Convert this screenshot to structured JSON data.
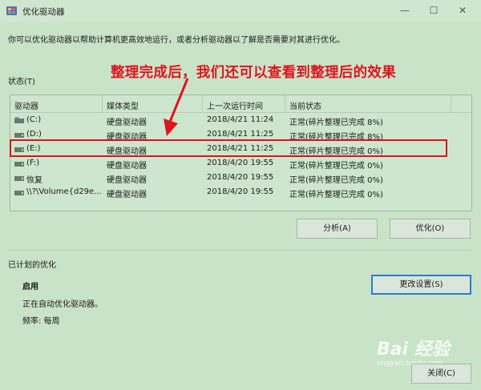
{
  "window": {
    "title": "优化驱动器"
  },
  "description": "你可以优化驱动器以帮助计算机更高效地运行，或者分析驱动器以了解是否需要对其进行优化。",
  "annotation": "整理完成后，我们还可以查看到整理后的效果",
  "status_label": "状态(T)",
  "table": {
    "headers": [
      "驱动器",
      "媒体类型",
      "上一次运行时间",
      "当前状态"
    ],
    "rows": [
      {
        "drive": "(C:)",
        "media": "硬盘驱动器",
        "last_run": "2018/4/21 11:24",
        "status": "正常(碎片整理已完成 8%)"
      },
      {
        "drive": "(D:)",
        "media": "硬盘驱动器",
        "last_run": "2018/4/21 11:25",
        "status": "正常(碎片整理已完成 8%)"
      },
      {
        "drive": "(E:)",
        "media": "硬盘驱动器",
        "last_run": "2018/4/21 11:25",
        "status": "正常(碎片整理已完成 0%)"
      },
      {
        "drive": "(F:)",
        "media": "硬盘驱动器",
        "last_run": "2018/4/20 19:55",
        "status": "正常(碎片整理已完成 0%)"
      },
      {
        "drive": "恢复",
        "media": "硬盘驱动器",
        "last_run": "2018/4/20 19:55",
        "status": "正常(碎片整理已完成 0%)"
      },
      {
        "drive": "\\\\?\\Volume{d29e...",
        "media": "硬盘驱动器",
        "last_run": "2018/4/20 19:55",
        "status": "正常(碎片整理已完成 0%)"
      }
    ]
  },
  "buttons": {
    "analyze": "分析(A)",
    "optimize": "优化(O)",
    "change_settings": "更改设置(S)",
    "close": "关闭(C)"
  },
  "scheduled": {
    "label": "已计划的优化",
    "title": "启用",
    "status": "正在自动优化驱动器。",
    "frequency": "频率: 每周"
  },
  "watermark": {
    "main": "Bai 经验",
    "sub": "jingyan.baidu.com"
  },
  "icons": {
    "app": "defrag-app-icon",
    "drive": "hard-drive-icon",
    "system_drive": "windows-drive-icon"
  },
  "colors": {
    "annotation": "#e0141c",
    "highlight": "#d9141c",
    "focus_border": "#2f7bd1"
  }
}
